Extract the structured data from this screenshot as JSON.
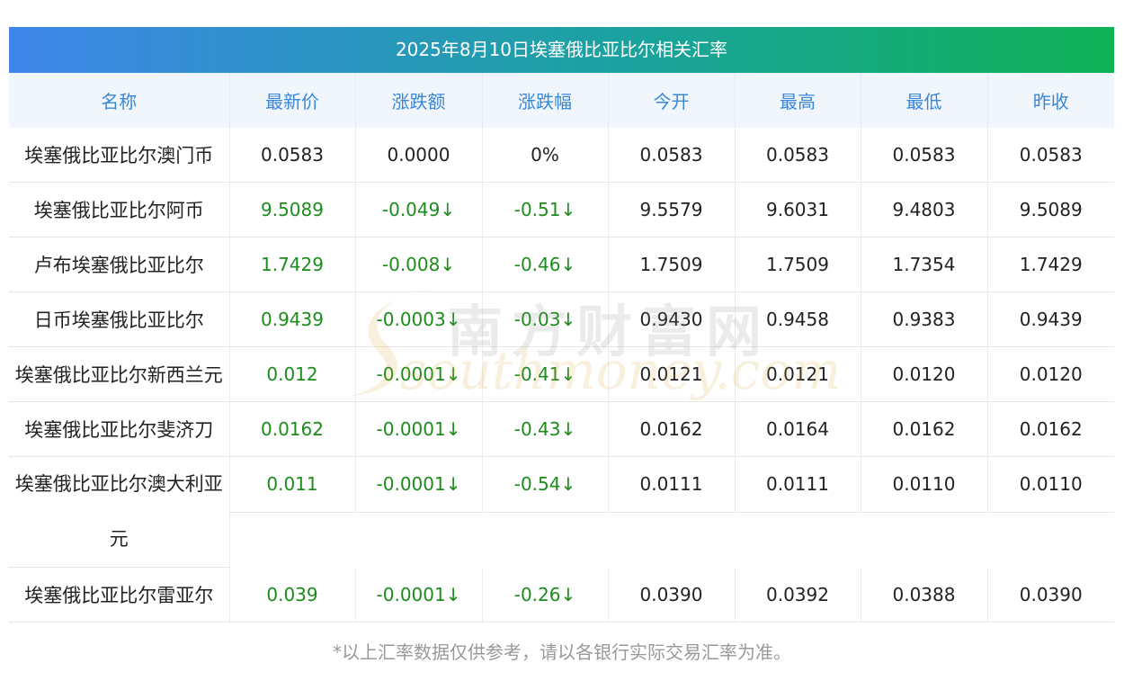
{
  "title": "2025年8月10日埃塞俄比亚比尔相关汇率",
  "columns": [
    "名称",
    "最新价",
    "涨跌额",
    "涨跌幅",
    "今开",
    "最高",
    "最低",
    "昨收"
  ],
  "rows": [
    {
      "name": "埃塞俄比亚比尔澳门币",
      "latest": "0.0583",
      "change": "0.0000",
      "pct": "0%",
      "open": "0.0583",
      "high": "0.0583",
      "low": "0.0583",
      "prev": "0.0583",
      "down": false
    },
    {
      "name": "埃塞俄比亚比尔阿币",
      "latest": "9.5089",
      "change": "-0.049↓",
      "pct": "-0.51↓",
      "open": "9.5579",
      "high": "9.6031",
      "low": "9.4803",
      "prev": "9.5089",
      "down": true
    },
    {
      "name": "卢布埃塞俄比亚比尔",
      "latest": "1.7429",
      "change": "-0.008↓",
      "pct": "-0.46↓",
      "open": "1.7509",
      "high": "1.7509",
      "low": "1.7354",
      "prev": "1.7429",
      "down": true
    },
    {
      "name": "日币埃塞俄比亚比尔",
      "latest": "0.9439",
      "change": "-0.0003↓",
      "pct": "-0.03↓",
      "open": "0.9430",
      "high": "0.9458",
      "low": "0.9383",
      "prev": "0.9439",
      "down": true
    },
    {
      "name": "埃塞俄比亚比尔新西兰元",
      "latest": "0.012",
      "change": "-0.0001↓",
      "pct": "-0.41↓",
      "open": "0.0121",
      "high": "0.0121",
      "low": "0.0120",
      "prev": "0.0120",
      "down": true
    },
    {
      "name": "埃塞俄比亚比尔斐济刀",
      "latest": "0.0162",
      "change": "-0.0001↓",
      "pct": "-0.43↓",
      "open": "0.0162",
      "high": "0.0164",
      "low": "0.0162",
      "prev": "0.0162",
      "down": true
    },
    {
      "name": "埃塞俄比亚比尔澳大利亚元",
      "latest": "0.011",
      "change": "-0.0001↓",
      "pct": "-0.54↓",
      "open": "0.0111",
      "high": "0.0111",
      "low": "0.0110",
      "prev": "0.0110",
      "down": true
    },
    {
      "name": "埃塞俄比亚比尔雷亚尔",
      "latest": "0.039",
      "change": "-0.0001↓",
      "pct": "-0.26↓",
      "open": "0.0390",
      "high": "0.0392",
      "low": "0.0388",
      "prev": "0.0390",
      "down": true
    }
  ],
  "footnote": "*以上汇率数据仅供参考，请以各银行实际交易汇率为准。",
  "watermark": {
    "cn": "南方财富网",
    "en": "southmoney.com"
  },
  "colors": {
    "header_text": "#3a87d9",
    "down": "#1c8c1c",
    "title_from": "#3f86ea",
    "title_to": "#0fb155"
  }
}
